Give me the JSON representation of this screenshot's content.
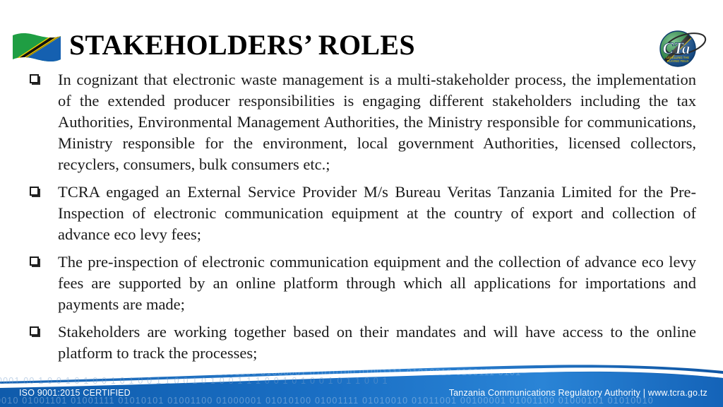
{
  "slide": {
    "title": "STAKEHOLDERS’ ROLES",
    "flag_icon": "tanzania-flag-icon",
    "logo_icon": "tcra-globe-logo",
    "logo_text": "TCRA",
    "background_color": "#ffffff",
    "text_color": "#1a1a1a"
  },
  "bullets": [
    {
      "marker": "hollow-square-bullet",
      "text": "In cognizant that electronic waste management is a multi-stakeholder process,  the implementation of the extended producer responsibilities is engaging different stakeholders including the tax Authorities, Environmental Management Authorities, the Ministry responsible for communications, Ministry responsible for the environment, local government Authorities, licensed collectors, recyclers, consumers, bulk consumers etc.;"
    },
    {
      "marker": "hollow-square-bullet",
      "text": "TCRA engaged an External Service Provider M/s Bureau Veritas Tanzania Limited for the Pre-Inspection of electronic communication equipment at the country of export and collection of advance eco levy fees;"
    },
    {
      "marker": "hollow-square-bullet",
      "text": "The pre-inspection of electronic communication equipment and the collection of advance eco levy fees are supported by an online platform through which all applications for importations and payments are made;"
    },
    {
      "marker": "hollow-square-bullet",
      "text": "Stakeholders are working together based on their mandates and will have access to the online platform to track the processes;"
    }
  ],
  "footer": {
    "left": "ISO 9001:2015 CERTIFIED",
    "right": "Tanzania Communications Regulatory Authority | www.tcra.go.tz",
    "band_color": "#1667bd",
    "band_color_light": "#2f86d6",
    "binary_decor_1": "0001 00 1 0 0 1 0 1 0 0 1 0 1 0 0 1 1 0 0 1 0 1 0 0 1 1 1 0 0 1 0 1 0 0 1 0 1 1 0 0 1",
    "binary_decor_2": "0010 01001101 01001111 01010101 01001100 01000001 01010100 01001111 01010010 01011001 00100001 01001100 01000101 01010010",
    "binary_decor_3": "01001100 01000001 01010100 01001111 01010010 0100111 0101"
  }
}
